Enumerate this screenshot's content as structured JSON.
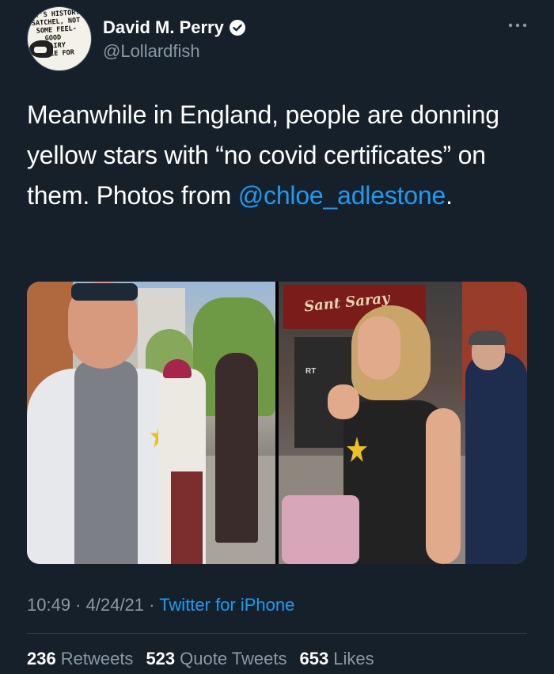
{
  "author": {
    "display_name": "David M. Perry",
    "handle": "@Lollardfish",
    "avatar_text": "IT'S HISTORY\nSATCHEL, NOT\n SOME FEEL-\n   GOOD\n   FAIRY\n  TALE FOR"
  },
  "tweet": {
    "text_before": "Meanwhile in England, people are donning yellow stars with “no covid certificates” on them. Photos from ",
    "mention": "@chloe_adlestone",
    "text_after": "."
  },
  "media": {
    "left_sign": "",
    "right_sign": "Sant Saray",
    "right_sign_small": "RT"
  },
  "meta": {
    "time": "10:49",
    "sep1": " · ",
    "date": "4/24/21",
    "sep2": " · ",
    "source": "Twitter for iPhone"
  },
  "stats": {
    "retweets_count": "236",
    "retweets_label": "Retweets",
    "quotes_count": "523",
    "quotes_label": "Quote Tweets",
    "likes_count": "653",
    "likes_label": "Likes"
  },
  "colors": {
    "background": "#15202b",
    "link": "#1d9bf0",
    "secondary_text": "#8b98a5"
  },
  "icons": [
    "verified-icon",
    "more-icon"
  ]
}
